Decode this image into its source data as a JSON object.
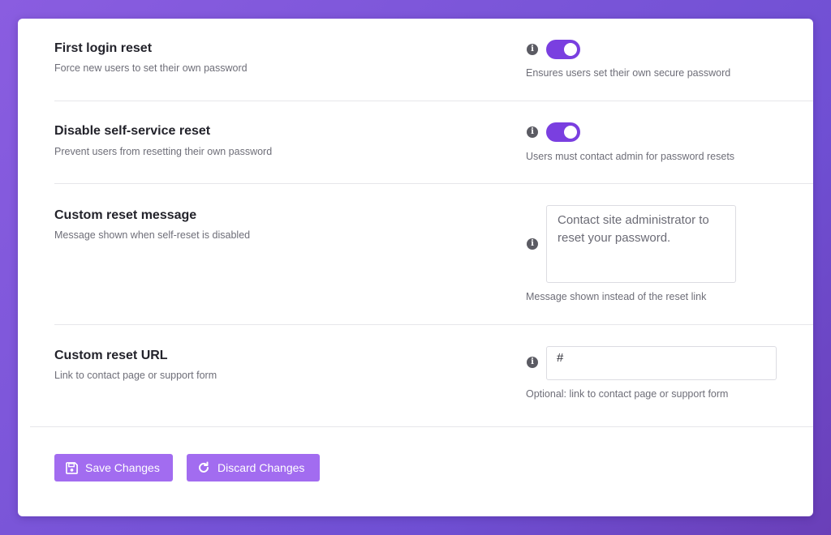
{
  "settings": {
    "first_login_reset": {
      "title": "First login reset",
      "description": "Force new users to set their own password",
      "enabled": true,
      "helper": "Ensures users set their own secure password"
    },
    "disable_self_service": {
      "title": "Disable self-service reset",
      "description": "Prevent users from resetting their own password",
      "enabled": true,
      "helper": "Users must contact admin for password resets"
    },
    "custom_message": {
      "title": "Custom reset message",
      "description": "Message shown when self-reset is disabled",
      "value": "Contact site administrator to reset your password.",
      "helper": "Message shown instead of the reset link"
    },
    "custom_url": {
      "title": "Custom reset URL",
      "description": "Link to contact page or support form",
      "value": "#",
      "helper": "Optional: link to contact page or support form"
    }
  },
  "actions": {
    "save_label": "Save Changes",
    "discard_label": "Discard Changes"
  },
  "icons": {
    "info": "info-icon",
    "save": "floppy-disk-icon",
    "discard": "refresh-icon"
  },
  "colors": {
    "accent": "#7a3fe0",
    "button": "#a26cf0"
  }
}
